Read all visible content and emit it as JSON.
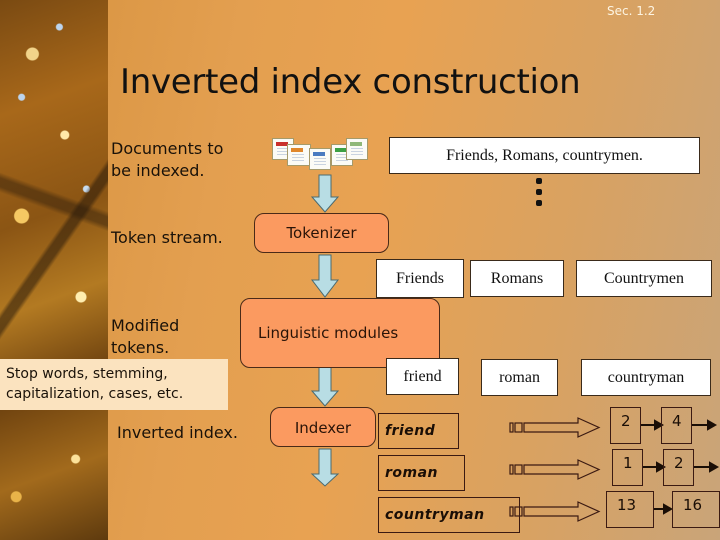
{
  "slide": {
    "section": "Sec. 1.2",
    "title": "Inverted index construction"
  },
  "left_labels": {
    "documents": "Documents to be indexed.",
    "token_stream": "Token stream.",
    "modified_tokens": "Modified tokens.",
    "inverted_index": "Inverted index."
  },
  "callout": {
    "line1": "Stop words, stemming,",
    "line2": "capitalization, cases, etc."
  },
  "document_icons": [
    "pdf-icon",
    "html-icon",
    "doc-icon",
    "spreadsheet-icon",
    "text-file-icon"
  ],
  "source_text": "Friends, Romans, countrymen.",
  "ellipsis_icon": "vertical-ellipsis-icon",
  "modules": {
    "tokenizer": "Tokenizer",
    "linguistic": "Linguistic modules",
    "indexer": "Indexer"
  },
  "tokens": [
    "Friends",
    "Romans",
    "Countrymen"
  ],
  "normalized_tokens": [
    "friend",
    "roman",
    "countryman"
  ],
  "index": [
    {
      "term": "friend",
      "postings": [
        "2",
        "4"
      ]
    },
    {
      "term": "roman",
      "postings": [
        "1",
        "2"
      ]
    },
    {
      "term": "countryman",
      "postings": [
        "13",
        "16"
      ]
    }
  ],
  "colors": {
    "module_fill": "#fb9a60",
    "flow_arrow": "#b8dde4",
    "callout_fill": "#fbe3bf"
  }
}
